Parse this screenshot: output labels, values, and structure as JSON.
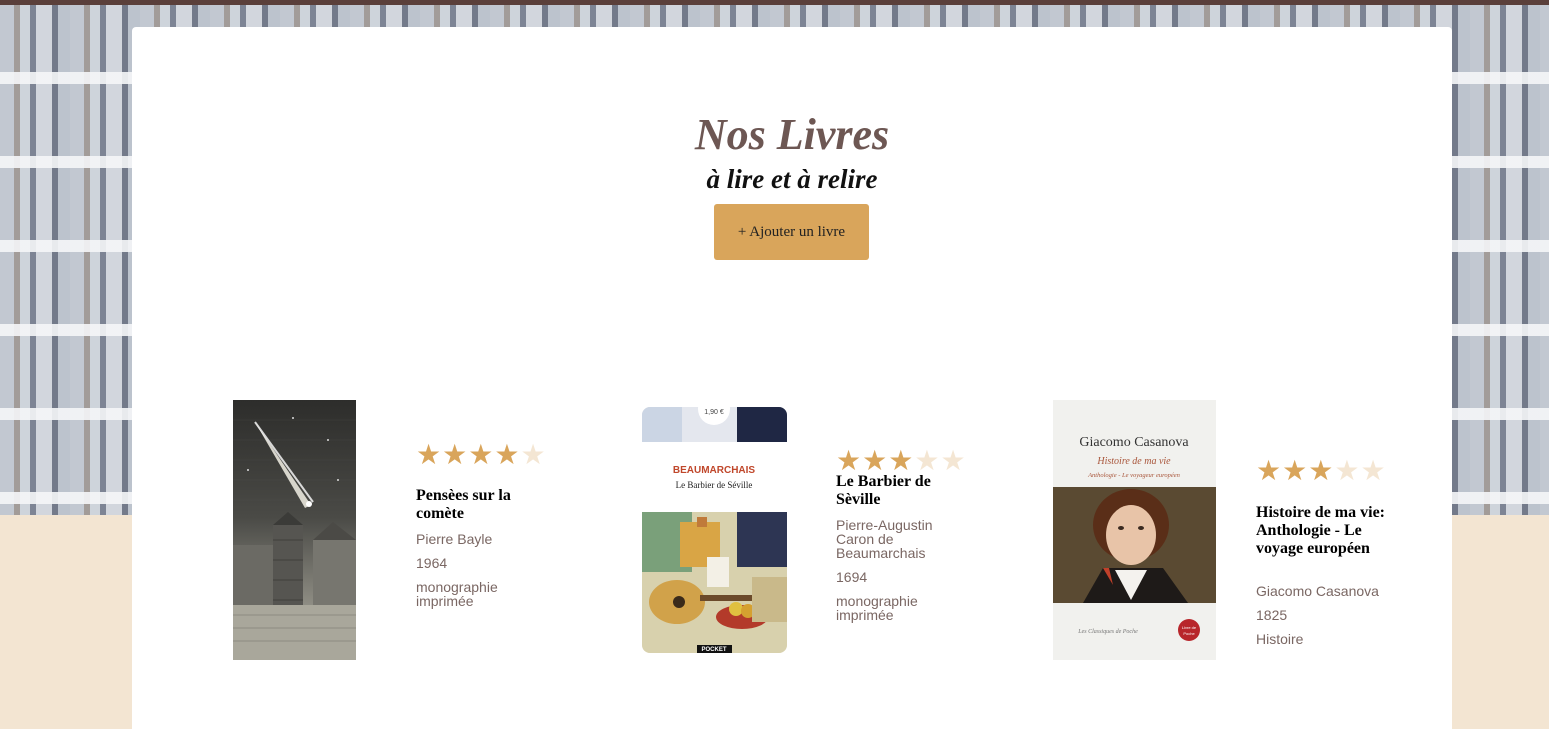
{
  "header": {
    "title": "Nos Livres",
    "subtitle": "à lire et à relire",
    "add_button": "+ Ajouter un livre"
  },
  "colors": {
    "accent": "#d9a55b",
    "title": "#6d5753",
    "meta_text": "#7a6763",
    "page_bg": "#f3e5d2",
    "star_off": "#f4e6d3"
  },
  "books": [
    {
      "title": "Pensèes sur la comète",
      "author": "Pierre Bayle",
      "year": "1964",
      "type": "monographie imprimée",
      "rating": 4,
      "max_rating": 5,
      "cover": {
        "kind": "engraving-comet"
      }
    },
    {
      "title": "Le Barbier de Sèville",
      "author": "Pierre-Augustin Caron de Beaumarchais",
      "year": "1694",
      "type": "monographie imprimée",
      "rating": 3,
      "max_rating": 5,
      "cover": {
        "price": "1,90 €",
        "author": "BEAUMARCHAIS",
        "title": "Le Barbier de Séville",
        "publisher": "POCKET"
      }
    },
    {
      "title": "Histoire de ma vie: Anthologie - Le voyage européen",
      "author": "Giacomo Casanova",
      "year": "1825",
      "type": "Histoire",
      "rating": 3,
      "max_rating": 5,
      "cover": {
        "author": "Giacomo Casanova",
        "title": "Histoire de ma vie",
        "subtitle": "Anthologie - Le voyageur européen",
        "collection": "Les Classiques de Poche",
        "logo": "Le Livre de Poche"
      }
    }
  ]
}
